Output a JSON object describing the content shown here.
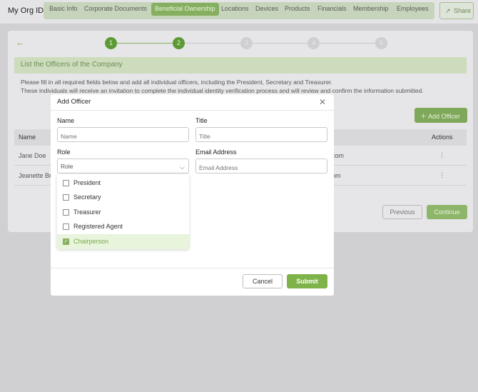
{
  "header": {
    "brand": "My Org ID",
    "nav": [
      "Basic Info",
      "Corporate Documents",
      "Beneficial Ownership",
      "Locations",
      "Devices",
      "Products",
      "Financials",
      "Membership",
      "Employees"
    ],
    "active_nav": "Beneficial Ownership",
    "share_label": "Share"
  },
  "stepper": {
    "steps": [
      "1",
      "2",
      "3",
      "4",
      "5"
    ],
    "current_step": 2
  },
  "page": {
    "section_title": "List the Officers of the Company",
    "instruction_line1": "Please fill in all required fields below and add all individual officers, including the President, Secretary and Treasurer.",
    "instruction_line2": "These individuals will receive an invitation to complete the individual identity verification process and will review and confirm the information submitted.",
    "add_officer_label": "Add Officer",
    "table": {
      "columns": [
        "Name",
        "Actions"
      ],
      "rows": [
        {
          "name": "Jane Doe",
          "email_tail": "com"
        },
        {
          "name": "Jeanette Br",
          "email_tail": "om"
        }
      ]
    },
    "previous_label": "Previous",
    "continue_label": "Continue"
  },
  "modal": {
    "title": "Add Officer",
    "name_label": "Name",
    "name_placeholder": "Name",
    "title_label": "Title",
    "title_placeholder": "Title",
    "role_label": "Role",
    "role_placeholder": "Role",
    "email_label": "Email Address",
    "email_placeholder": "Email Address",
    "role_options": [
      {
        "label": "President",
        "checked": false
      },
      {
        "label": "Secretary",
        "checked": false
      },
      {
        "label": "Treasurer",
        "checked": false
      },
      {
        "label": "Registered Agent",
        "checked": false
      },
      {
        "label": "Chairperson",
        "checked": true
      }
    ],
    "cancel_label": "Cancel",
    "submit_label": "Submit"
  },
  "colors": {
    "accent": "#7fb349",
    "overlay": "#d0d0d3"
  }
}
